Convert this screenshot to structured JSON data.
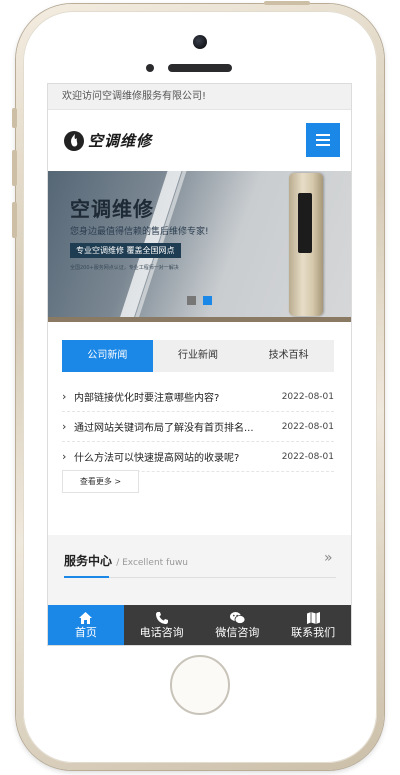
{
  "topbar": {
    "welcome": "欢迎访问空调维修服务有限公司!"
  },
  "header": {
    "logo_text": "空调维修",
    "menu_icon": "hamburger-menu-icon"
  },
  "banner": {
    "title": "空调维修",
    "subtitle": "您身边最值得信赖的售后维修专家!",
    "tag": "专业空调维修  覆盖全国网点",
    "small_text": "全国200+服务网点认证，专业工程师一对一解决",
    "slide_count": 2,
    "active_slide": 2
  },
  "news_tabs": [
    {
      "label": "公司新闻",
      "active": true
    },
    {
      "label": "行业新闻",
      "active": false
    },
    {
      "label": "技术百科",
      "active": false
    }
  ],
  "news": [
    {
      "title": "内部链接优化时要注意哪些内容?",
      "date": "2022-08-01"
    },
    {
      "title": "通过网站关键词布局了解没有首页排名...",
      "date": "2022-08-01"
    },
    {
      "title": "什么方法可以快速提高网站的收录呢?",
      "date": "2022-08-01"
    }
  ],
  "more_label": "查看更多 >",
  "service": {
    "title": "服务中心",
    "subtitle": "/ Excellent fuwu",
    "arrow_icon": "double-chevron-right-icon"
  },
  "bottom_nav": [
    {
      "label": "首页",
      "icon": "home-icon",
      "active": true
    },
    {
      "label": "电话咨询",
      "icon": "phone-icon",
      "active": false
    },
    {
      "label": "微信咨询",
      "icon": "wechat-icon",
      "active": false
    },
    {
      "label": "联系我们",
      "icon": "map-icon",
      "active": false
    }
  ],
  "colors": {
    "accent": "#1b87e6",
    "nav_bg": "#3b3b3b",
    "tab_bg": "#efefef",
    "frame_gold": "#d7ccb8"
  }
}
